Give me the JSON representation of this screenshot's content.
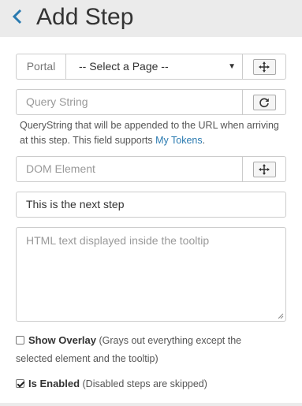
{
  "header": {
    "title": "Add Step",
    "back_icon": "chevron-left-icon"
  },
  "portal": {
    "label": "Portal",
    "selected": "-- Select a Page --",
    "target_icon": "crosshair-icon"
  },
  "query": {
    "placeholder": "Query String",
    "refresh_icon": "refresh-icon",
    "help_text": "QueryString that will be appended to the URL when arriving at this step. This field supports ",
    "help_link": "My Tokens",
    "help_end": "."
  },
  "dom": {
    "placeholder": "DOM Element",
    "target_icon": "crosshair-icon"
  },
  "step_title": {
    "value": "This is the next step"
  },
  "html": {
    "placeholder": "HTML text displayed inside the tooltip"
  },
  "overlay": {
    "label": "Show Overlay",
    "desc": "(Grays out everything except the",
    "desc2": "selected element and the tooltip)",
    "checked": false
  },
  "enabled": {
    "label": "Is Enabled",
    "desc": "(Disabled steps are skipped)",
    "checked": true
  },
  "colors": {
    "accent": "#2a7ab0",
    "header_bg": "#ebebeb"
  }
}
